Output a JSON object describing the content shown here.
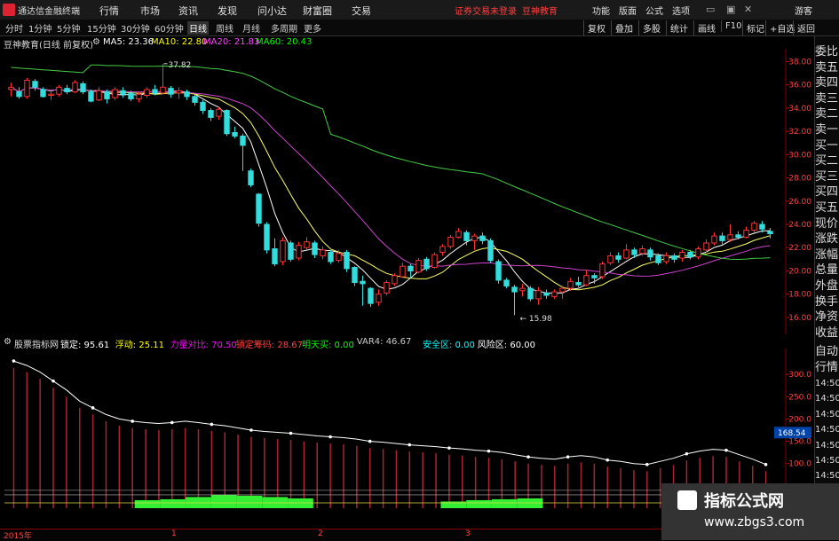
{
  "app": {
    "name": "通达信金融终端"
  },
  "menu": {
    "items": [
      "分时",
      "1分钟",
      "5分钟",
      "15分钟",
      "30分钟",
      "60分钟",
      "日线",
      "周线",
      "月线",
      "多周期",
      "更多"
    ],
    "top": [
      "行情",
      "市场",
      "资讯",
      "发现",
      "问小达",
      "财富圈",
      "交易"
    ],
    "notice": "证券交易未登录",
    "broker": "豆神教育",
    "right": [
      "功能",
      "版面",
      "公式",
      "选项"
    ],
    "guest": "游客"
  },
  "toolbar": {
    "right": [
      "复权",
      "叠加",
      "多股",
      "统计",
      "画线",
      "F10",
      "标记",
      "+自选",
      "返回"
    ]
  },
  "chart_legend": {
    "stock": "豆神教育(日线 前复权)",
    "ma5": "MA5: 23.36",
    "ma10": "MA10: 22.80",
    "ma20": "MA20: 21.83",
    "ma60": "MA60: 20.43"
  },
  "indicator_legend": {
    "name": "股票指标网",
    "items": [
      {
        "label": "锁定: 95.61",
        "color": "#ffffff"
      },
      {
        "label": "浮动: 25.11",
        "color": "#ffff00"
      },
      {
        "label": "力量对比: 70.50",
        "color": "#ff00ff"
      },
      {
        "label": "锁定筹码: 28.67",
        "color": "#ff4040"
      },
      {
        "label": "明天买: 0.00",
        "color": "#00ff00"
      },
      {
        "label": "VAR4: 46.67",
        "color": "#cccccc"
      },
      {
        "label": "安全区: 0.00",
        "color": "#00ffff"
      },
      {
        "label": "风险区: 60.00",
        "color": "#ffffff"
      }
    ]
  },
  "right_panel": {
    "top": [
      "委比",
      "卖五",
      "卖四",
      "卖三",
      "卖二",
      "卖一",
      "买一",
      "买二",
      "买三",
      "买四",
      "买五",
      "现价",
      "涨跌",
      "涨幅",
      "总量",
      "外盘",
      "换手",
      "净资",
      "收益"
    ],
    "bottom": [
      "自动",
      "行情"
    ],
    "times": [
      "14:50",
      "14:50",
      "14:50",
      "14:50",
      "14:50",
      "14:50",
      "14:50",
      "14:50",
      "14:50"
    ]
  },
  "bottom_axis": {
    "labels": [
      "2015年",
      "1",
      "2",
      "3"
    ]
  },
  "watermark": {
    "title": "指标公式网",
    "url": "www.zbgs3.com"
  },
  "chart_data": {
    "type": "candlestick",
    "price_axis": [
      "38.00",
      "36.00",
      "34.00",
      "32.00",
      "30.00",
      "28.00",
      "26.00",
      "24.00",
      "22.00",
      "20.00",
      "18.00",
      "16.00"
    ],
    "ylim": [
      15.0,
      38.8
    ],
    "annotations": [
      {
        "text": "37.82",
        "value": 37.82
      },
      {
        "text": "15.98",
        "value": 15.98
      }
    ],
    "candles": [
      [
        35.6,
        35.8,
        36.2,
        35.0
      ],
      [
        35.4,
        35.0,
        35.8,
        34.8
      ],
      [
        35.0,
        36.4,
        36.6,
        34.8
      ],
      [
        36.3,
        35.8,
        36.5,
        35.5
      ],
      [
        35.6,
        35.0,
        35.8,
        34.9
      ],
      [
        35.1,
        35.2,
        35.6,
        34.7
      ],
      [
        35.2,
        35.8,
        36.0,
        35.0
      ],
      [
        35.7,
        35.4,
        36.0,
        35.2
      ],
      [
        35.4,
        36.2,
        36.4,
        35.3
      ],
      [
        36.1,
        35.4,
        36.3,
        35.2
      ],
      [
        35.4,
        34.6,
        35.6,
        34.5
      ],
      [
        34.7,
        35.5,
        35.8,
        34.6
      ],
      [
        35.4,
        34.8,
        35.6,
        34.4
      ],
      [
        34.9,
        35.6,
        35.8,
        34.7
      ],
      [
        35.5,
        35.2,
        35.8,
        34.9
      ],
      [
        35.3,
        34.8,
        35.5,
        34.6
      ],
      [
        34.8,
        35.2,
        35.4,
        34.5
      ],
      [
        35.1,
        35.6,
        35.8,
        34.9
      ],
      [
        35.6,
        35.3,
        36.0,
        35.1
      ],
      [
        35.3,
        35.8,
        37.8,
        35.2
      ],
      [
        35.7,
        35.2,
        35.9,
        34.9
      ],
      [
        35.3,
        35.5,
        35.8,
        34.8
      ],
      [
        35.4,
        35.0,
        35.6,
        34.7
      ],
      [
        35.0,
        34.5,
        35.2,
        34.2
      ],
      [
        34.5,
        33.8,
        34.7,
        33.5
      ],
      [
        33.8,
        33.2,
        34.0,
        32.9
      ],
      [
        33.3,
        33.9,
        34.1,
        33.0
      ],
      [
        33.8,
        31.8,
        33.9,
        31.6
      ],
      [
        31.9,
        31.6,
        32.4,
        31.4
      ],
      [
        31.6,
        30.8,
        31.8,
        28.6
      ],
      [
        28.6,
        27.4,
        28.8,
        27.2
      ],
      [
        26.6,
        24.1,
        26.7,
        23.8
      ],
      [
        24.0,
        21.8,
        24.2,
        21.5
      ],
      [
        21.9,
        20.6,
        22.8,
        20.4
      ],
      [
        20.8,
        22.6,
        22.9,
        20.5
      ],
      [
        22.4,
        21.0,
        22.6,
        20.8
      ],
      [
        21.1,
        22.2,
        22.5,
        20.9
      ],
      [
        22.0,
        22.5,
        22.9,
        21.8
      ],
      [
        22.4,
        21.4,
        22.6,
        21.1
      ],
      [
        21.3,
        21.8,
        22.1,
        21.0
      ],
      [
        21.6,
        20.8,
        21.8,
        20.6
      ],
      [
        20.9,
        21.5,
        21.8,
        20.7
      ],
      [
        21.6,
        20.2,
        21.8,
        19.9
      ],
      [
        20.3,
        19.0,
        20.4,
        18.7
      ],
      [
        19.1,
        18.9,
        19.6,
        17.0
      ],
      [
        18.5,
        17.2,
        18.6,
        16.9
      ],
      [
        17.3,
        18.0,
        18.4,
        17.0
      ],
      [
        18.1,
        19.0,
        19.2,
        17.9
      ],
      [
        18.9,
        19.6,
        19.8,
        18.7
      ],
      [
        19.5,
        20.4,
        20.7,
        19.4
      ],
      [
        20.4,
        20.0,
        20.6,
        19.4
      ],
      [
        19.9,
        20.9,
        21.1,
        19.8
      ],
      [
        21.0,
        20.2,
        21.2,
        20.0
      ],
      [
        20.3,
        21.4,
        21.6,
        20.2
      ],
      [
        21.6,
        22.1,
        22.3,
        21.3
      ],
      [
        22.1,
        22.9,
        23.1,
        21.9
      ],
      [
        22.9,
        23.4,
        23.7,
        22.8
      ],
      [
        23.3,
        22.6,
        23.5,
        22.2
      ],
      [
        22.6,
        23.0,
        23.2,
        21.8
      ],
      [
        23.0,
        22.6,
        23.3,
        22.3
      ],
      [
        22.6,
        20.9,
        22.8,
        20.7
      ],
      [
        20.8,
        19.2,
        21.0,
        18.9
      ],
      [
        19.2,
        18.7,
        19.4,
        18.5
      ],
      [
        18.6,
        18.2,
        18.8,
        16.2
      ],
      [
        18.3,
        18.5,
        18.9,
        17.8
      ],
      [
        18.5,
        17.6,
        18.7,
        17.4
      ],
      [
        17.6,
        18.3,
        18.6,
        17.1
      ],
      [
        18.1,
        17.9,
        18.4,
        17.6
      ],
      [
        17.8,
        18.2,
        18.4,
        17.6
      ],
      [
        18.2,
        18.5,
        18.7,
        17.6
      ],
      [
        18.5,
        19.1,
        19.4,
        18.3
      ],
      [
        19.0,
        18.8,
        19.5,
        18.6
      ],
      [
        18.8,
        19.6,
        20.1,
        18.7
      ],
      [
        19.6,
        19.4,
        19.8,
        18.9
      ],
      [
        19.5,
        20.6,
        20.8,
        19.3
      ],
      [
        20.7,
        21.3,
        21.6,
        20.5
      ],
      [
        21.3,
        21.0,
        21.6,
        20.7
      ],
      [
        21.1,
        21.8,
        22.3,
        21.0
      ],
      [
        21.8,
        21.4,
        22.0,
        21.1
      ],
      [
        21.5,
        21.9,
        22.2,
        21.3
      ],
      [
        21.8,
        21.2,
        22.0,
        20.9
      ],
      [
        21.3,
        20.7,
        21.5,
        20.5
      ],
      [
        20.8,
        21.3,
        21.6,
        20.6
      ],
      [
        21.3,
        21.0,
        21.5,
        20.7
      ],
      [
        21.1,
        21.6,
        21.8,
        20.8
      ],
      [
        21.6,
        21.2,
        21.8,
        21.0
      ],
      [
        21.2,
        21.9,
        22.1,
        21.0
      ],
      [
        21.8,
        22.4,
        22.7,
        21.6
      ],
      [
        22.4,
        23.0,
        23.3,
        22.2
      ],
      [
        23.0,
        22.6,
        23.3,
        22.3
      ],
      [
        22.7,
        23.1,
        24.0,
        22.5
      ],
      [
        23.1,
        22.9,
        23.4,
        22.7
      ],
      [
        22.9,
        23.5,
        23.8,
        22.8
      ],
      [
        23.5,
        24.1,
        24.3,
        23.3
      ],
      [
        24.0,
        23.6,
        24.3,
        23.3
      ],
      [
        23.4,
        23.2,
        23.7,
        22.8
      ]
    ],
    "indicator_axis": [
      "300.0",
      "250.0",
      "200.0",
      "150.0",
      "100.0"
    ],
    "indicator_ylim": [
      0,
      350
    ],
    "indicator_current": "168.54",
    "lock_line": [
      330,
      320,
      305,
      285,
      265,
      240,
      225,
      210,
      200,
      195,
      192,
      190,
      192,
      195,
      192,
      188,
      185,
      180,
      175,
      172,
      170,
      168,
      165,
      162,
      160,
      158,
      155,
      150,
      148,
      145,
      142,
      140,
      138,
      135,
      133,
      130,
      128,
      125,
      120,
      115,
      112,
      110,
      115,
      118,
      115,
      108,
      105,
      100,
      98,
      105,
      112,
      122,
      128,
      132,
      130,
      120,
      110,
      98
    ],
    "fill_line": [
      20,
      22,
      25,
      28,
      22,
      18,
      20,
      25,
      30,
      28,
      25,
      22,
      18,
      15,
      12,
      10,
      12,
      15,
      18,
      20,
      22,
      25,
      28,
      26,
      24,
      22,
      20,
      18,
      15,
      12
    ]
  }
}
